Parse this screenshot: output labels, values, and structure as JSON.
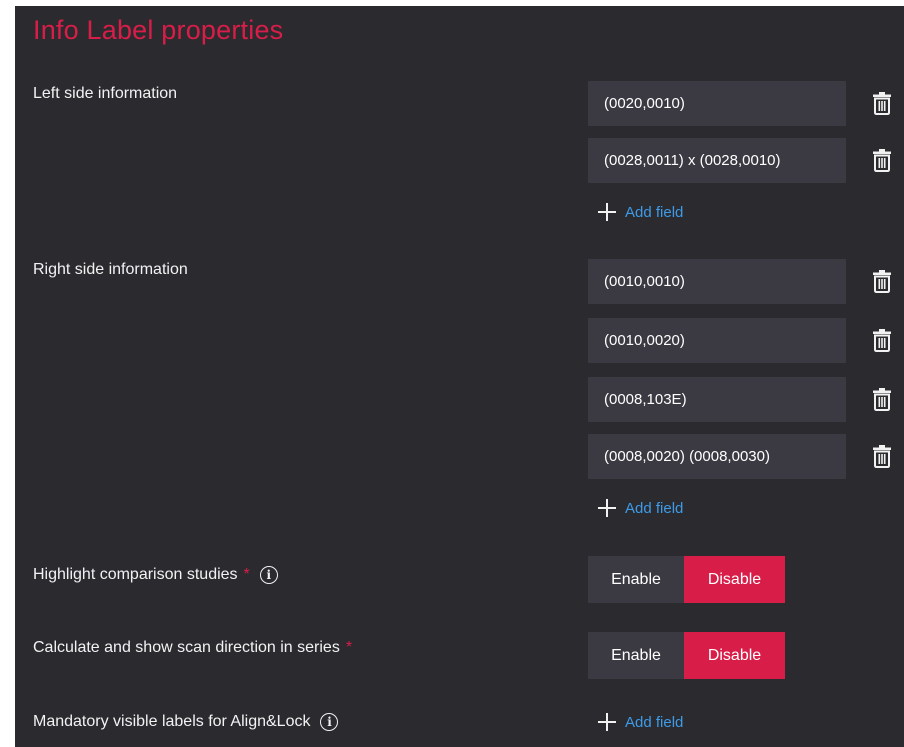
{
  "title": "Info Label properties",
  "left_side": {
    "label": "Left side information",
    "fields": [
      "(0020,0010)",
      "(0028,0011) x (0028,0010)"
    ],
    "add_label": "Add field"
  },
  "right_side": {
    "label": "Right side information",
    "fields": [
      "(0010,0010)",
      "(0010,0020)",
      "(0008,103E)",
      "(0008,0020) (0008,0030)"
    ],
    "add_label": "Add field"
  },
  "highlight": {
    "label": "Highlight comparison studies",
    "required_mark": "*",
    "enable_label": "Enable",
    "disable_label": "Disable",
    "selected": "Disable"
  },
  "scan_direction": {
    "label": "Calculate and show scan direction in series",
    "required_mark": "*",
    "enable_label": "Enable",
    "disable_label": "Disable",
    "selected": "Disable"
  },
  "align_lock": {
    "label": "Mandatory visible labels for Align&Lock",
    "add_label": "Add field"
  },
  "icons": {
    "info": "info-icon",
    "delete": "trash-icon",
    "add": "plus-icon"
  },
  "colors": {
    "accent": "#d81e48",
    "link": "#3d9be9",
    "panel_bg": "#2b2a2f",
    "field_bg": "#3b3a42"
  }
}
